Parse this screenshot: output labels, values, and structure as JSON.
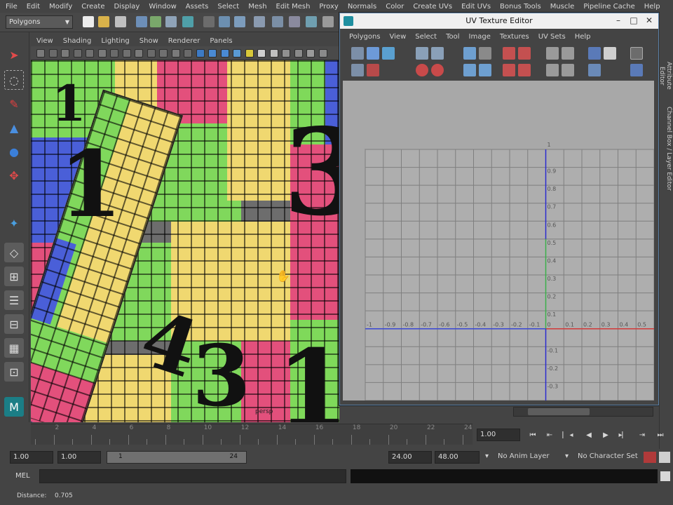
{
  "main_menu": [
    "File",
    "Edit",
    "Modify",
    "Create",
    "Display",
    "Window",
    "Assets",
    "Select",
    "Mesh",
    "Edit Mesh",
    "Proxy",
    "Normals",
    "Color",
    "Create UVs",
    "Edit UVs",
    "Bonus Tools",
    "Muscle",
    "Pipeline Cache",
    "Help"
  ],
  "status_line": {
    "mode": "Polygons"
  },
  "viewport": {
    "menu": [
      "View",
      "Shading",
      "Lighting",
      "Show",
      "Renderer",
      "Panels"
    ],
    "camera_label": "persp",
    "big_digits": [
      "1",
      "3",
      "1",
      "4",
      "3",
      "1"
    ]
  },
  "uv_editor": {
    "title": "UV Texture Editor",
    "menu": [
      "Polygons",
      "View",
      "Select",
      "Tool",
      "Image",
      "Textures",
      "UV Sets",
      "Help"
    ],
    "grid": {
      "x_range": [
        -1,
        0.5
      ],
      "y_range": [
        -0.3,
        1
      ],
      "x_ticks": [
        "-1",
        "-0.9",
        "-0.8",
        "-0.7",
        "-0.6",
        "-0.5",
        "-0.4",
        "-0.3",
        "-0.2",
        "-0.1",
        "0",
        "0.1",
        "0.2",
        "0.3",
        "0.4",
        "0.5",
        "0"
      ],
      "y_ticks_pos": [
        "1",
        "0.9",
        "0.8",
        "0.7",
        "0.6",
        "0.5",
        "0.4",
        "0.3",
        "0.2",
        "0.1"
      ],
      "y_ticks_neg": [
        "-0.1",
        "-0.2",
        "-0.3"
      ],
      "axis_u_color": "#d13a3a",
      "axis_u_neg_color": "#3a48d4",
      "axis_v_color": "#3ab04a",
      "axis_v_neg_color": "#2a2ad0",
      "canvas_color": "#a8a8a8"
    }
  },
  "right_tabs": [
    "Attribute Editor",
    "Channel Box / Layer Editor"
  ],
  "time_slider": {
    "tick_labels": [
      "2",
      "4",
      "6",
      "8",
      "10",
      "12",
      "14",
      "16",
      "18",
      "20",
      "22",
      "24"
    ],
    "current_frame": "1.00"
  },
  "playback_buttons": [
    "go-to-start",
    "step-back-key",
    "step-back-frame",
    "play-backward",
    "play-forward",
    "step-forward-frame",
    "step-forward-key",
    "go-to-end"
  ],
  "range": {
    "start": "1.00",
    "playback_start": "1.00",
    "slider_left": "1",
    "slider_right": "24",
    "playback_end": "24.00",
    "end": "48.00",
    "anim_layer": "No Anim Layer",
    "character_set": "No Character Set"
  },
  "command_line": {
    "label": "MEL"
  },
  "help_line": {
    "label": "Distance:",
    "value": "0.705"
  }
}
